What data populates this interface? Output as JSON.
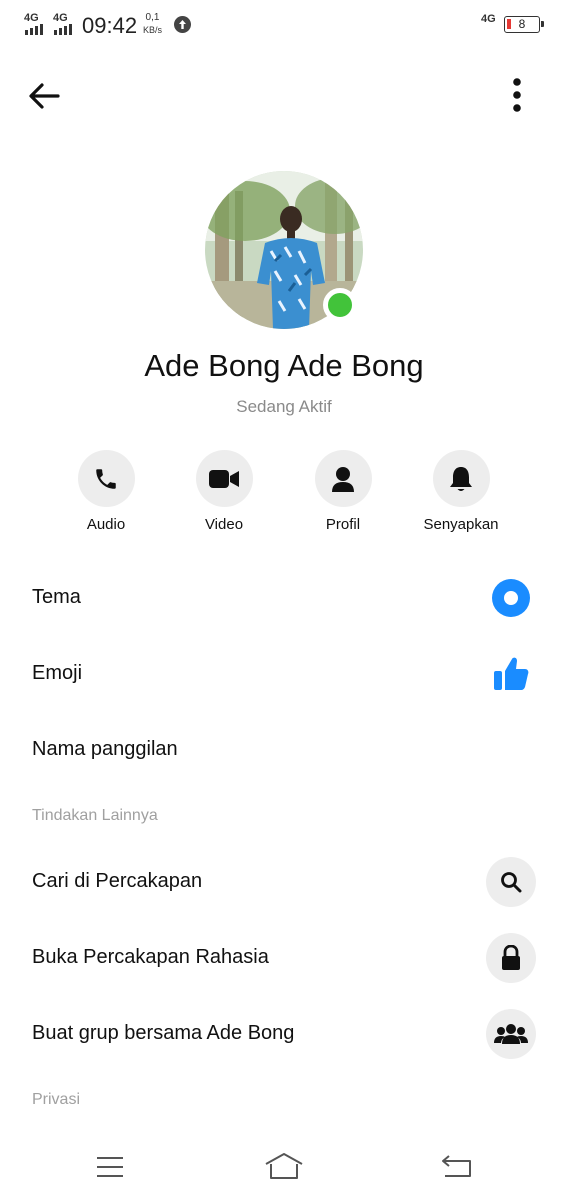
{
  "status_bar": {
    "network_left_1": "4G",
    "network_left_2": "4G",
    "time": "09:42",
    "speed_value": "0,1",
    "speed_unit": "KB/s",
    "network_right": "4G",
    "battery_level": "8"
  },
  "header": {
    "back_icon": "arrow-left-icon",
    "more_icon": "more-vertical-icon"
  },
  "profile": {
    "name": "Ade Bong Ade Bong",
    "status": "Sedang Aktif",
    "online_color": "#42c33a"
  },
  "actions": [
    {
      "label": "Audio",
      "icon": "phone-icon"
    },
    {
      "label": "Video",
      "icon": "video-camera-icon"
    },
    {
      "label": "Profil",
      "icon": "person-icon"
    },
    {
      "label": "Senyapkan",
      "icon": "bell-icon"
    }
  ],
  "settings": {
    "theme_label": "Tema",
    "theme_color": "#1a8cff",
    "emoji_label": "Emoji",
    "emoji_icon": "thumbs-up-icon",
    "nickname_label": "Nama panggilan"
  },
  "more_actions": {
    "title": "Tindakan Lainnya",
    "items": [
      {
        "label": "Cari di Percakapan",
        "icon": "search-icon"
      },
      {
        "label": "Buka Percakapan Rahasia",
        "icon": "lock-icon"
      },
      {
        "label": "Buat grup bersama Ade Bong",
        "icon": "group-icon"
      }
    ]
  },
  "privacy": {
    "title": "Privasi"
  },
  "nav_bar": {
    "menu_icon": "menu-icon",
    "home_icon": "home-icon",
    "back_icon": "return-icon"
  }
}
